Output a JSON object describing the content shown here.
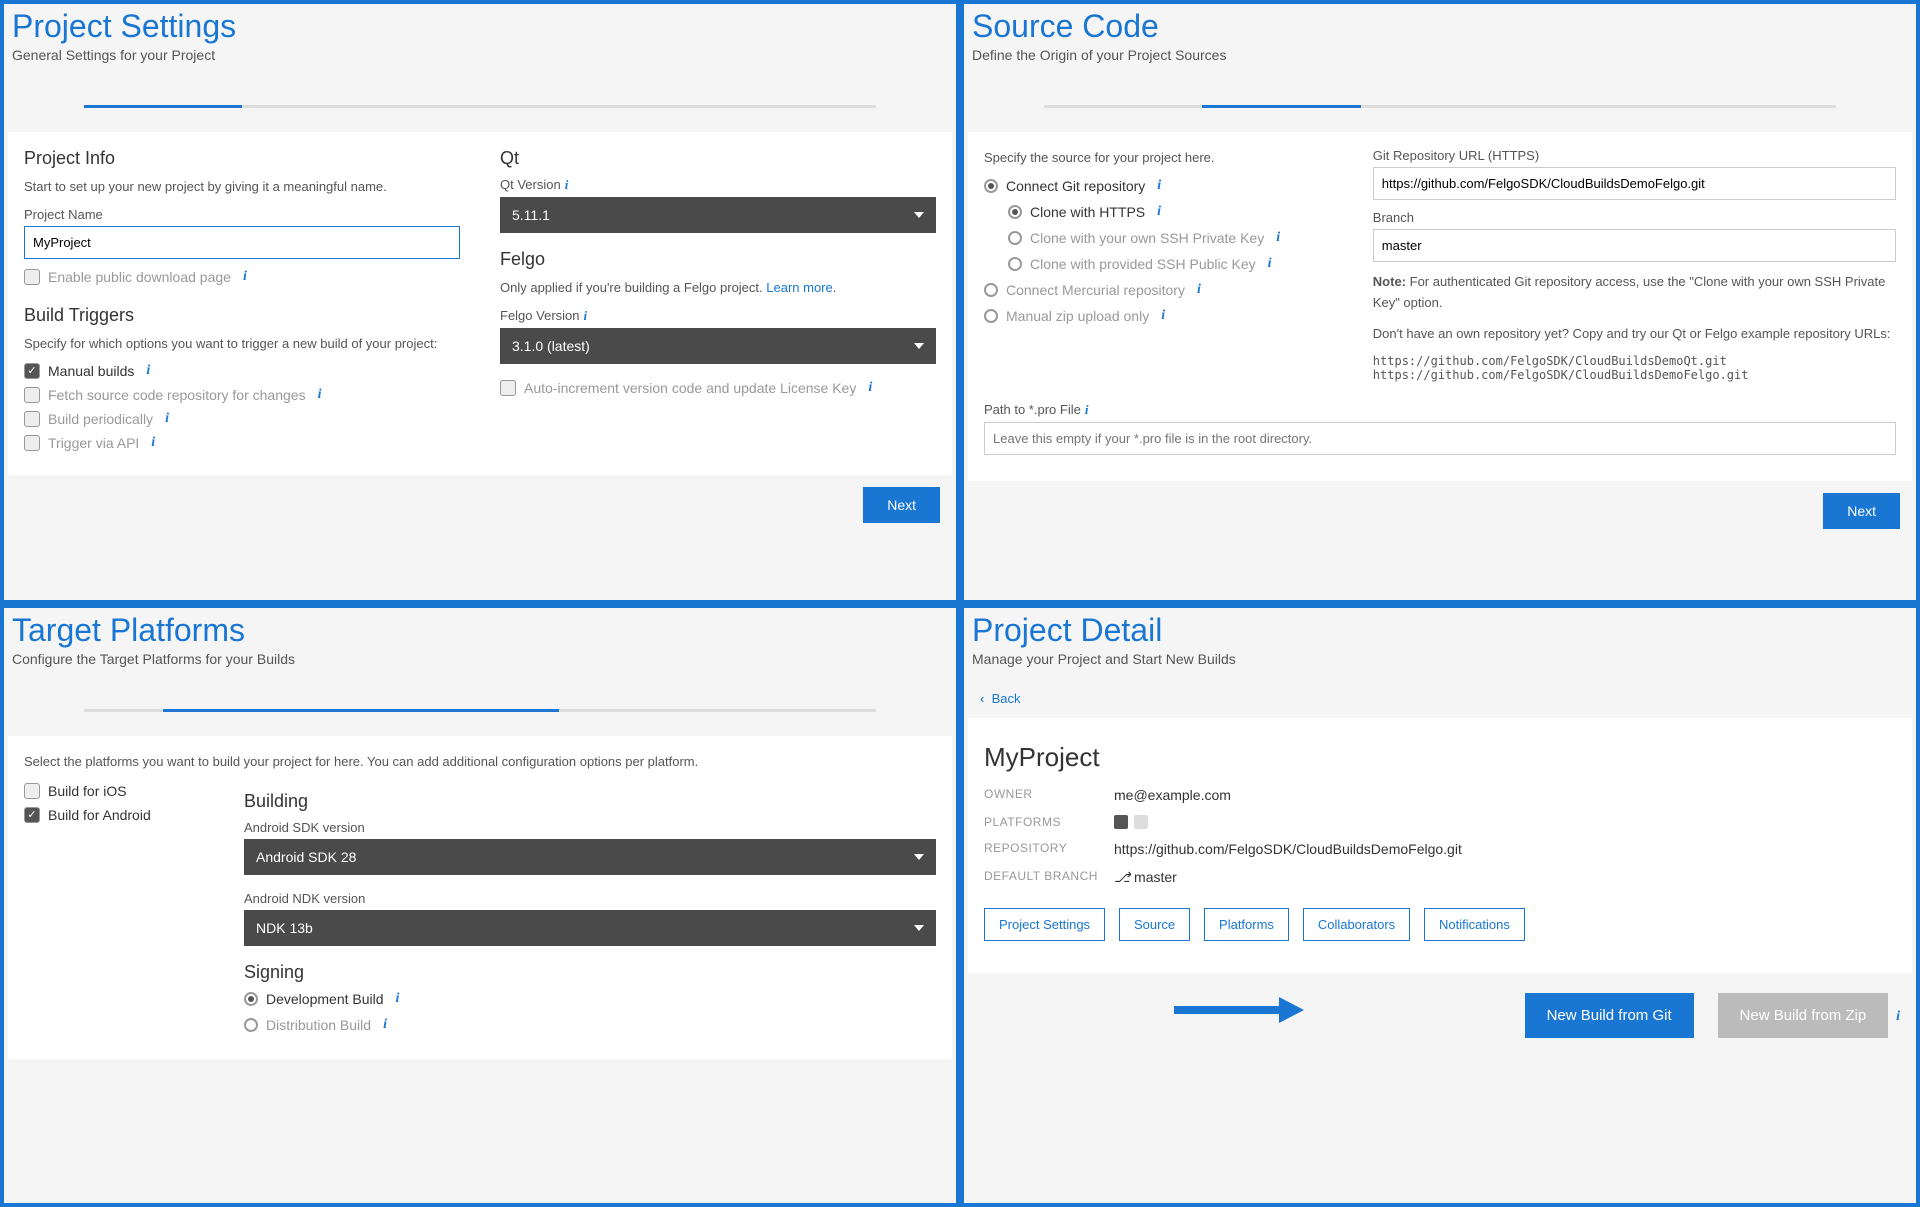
{
  "panels": {
    "settings": {
      "title": "Project Settings",
      "subtitle": "General Settings for your Project",
      "projectInfo": {
        "heading": "Project Info",
        "helper": "Start to set up your new project by giving it a meaningful name.",
        "nameLabel": "Project Name",
        "nameValue": "MyProject",
        "publicDownload": "Enable public download page"
      },
      "buildTriggers": {
        "heading": "Build Triggers",
        "helper": "Specify for which options you want to trigger a new build of your project:",
        "manual": "Manual builds",
        "fetch": "Fetch source code repository for changes",
        "periodic": "Build periodically",
        "api": "Trigger via API"
      },
      "qt": {
        "heading": "Qt",
        "versionLabel": "Qt Version",
        "versionValue": "5.11.1"
      },
      "felgo": {
        "heading": "Felgo",
        "helper": "Only applied if you're building a Felgo project. ",
        "learnMore": "Learn more",
        "versionLabel": "Felgo Version",
        "versionValue": "3.1.0 (latest)",
        "autoIncrement": "Auto-increment version code and update License Key"
      },
      "next": "Next"
    },
    "source": {
      "title": "Source Code",
      "subtitle": "Define the Origin of your Project Sources",
      "specifyLabel": "Specify the source for your project here.",
      "connectGit": "Connect Git repository",
      "cloneHttps": "Clone with HTTPS",
      "cloneSshKey": "Clone with your own SSH Private Key",
      "cloneSshPub": "Clone with provided SSH Public Key",
      "connectHg": "Connect Mercurial repository",
      "manualZip": "Manual zip upload only",
      "gitUrlLabel": "Git Repository URL (HTTPS)",
      "gitUrlValue": "https://github.com/FelgoSDK/CloudBuildsDemoFelgo.git",
      "branchLabel": "Branch",
      "branchValue": "master",
      "noteStrong": "Note:",
      "noteText": " For authenticated Git repository access, use the \"Clone with your own SSH Private Key\" option.",
      "noRepoText": "Don't have an own repository yet? Copy and try our Qt or Felgo example repository URLs:",
      "exUrl1": "https://github.com/FelgoSDK/CloudBuildsDemoQt.git",
      "exUrl2": "https://github.com/FelgoSDK/CloudBuildsDemoFelgo.git",
      "proPathLabel": "Path to *.pro File",
      "proPathPlaceholder": "Leave this empty if your *.pro file is in the root directory.",
      "next": "Next"
    },
    "platforms": {
      "title": "Target Platforms",
      "subtitle": "Configure the Target Platforms for your Builds",
      "selectText": "Select the platforms you want to build your project for here. You can add additional configuration options per platform.",
      "buildIos": "Build for iOS",
      "buildAndroid": "Build for Android",
      "buildingHeading": "Building",
      "sdkLabel": "Android SDK version",
      "sdkValue": "Android SDK 28",
      "ndkLabel": "Android NDK version",
      "ndkValue": "NDK 13b",
      "signingHeading": "Signing",
      "devBuild": "Development Build",
      "distBuild": "Distribution Build"
    },
    "detail": {
      "title": "Project Detail",
      "subtitle": "Manage your Project and Start New Builds",
      "back": "Back",
      "projName": "MyProject",
      "ownerK": "OWNER",
      "ownerV": "me@example.com",
      "platK": "PLATFORMS",
      "repoK": "REPOSITORY",
      "repoV": "https://github.com/FelgoSDK/CloudBuildsDemoFelgo.git",
      "branchK": "DEFAULT BRANCH",
      "branchV": "master",
      "tabs": {
        "settings": "Project Settings",
        "source": "Source",
        "platforms": "Platforms",
        "collab": "Collaborators",
        "notif": "Notifications"
      },
      "newBuildGit": "New Build from Git",
      "newBuildZip": "New Build from Zip"
    }
  }
}
